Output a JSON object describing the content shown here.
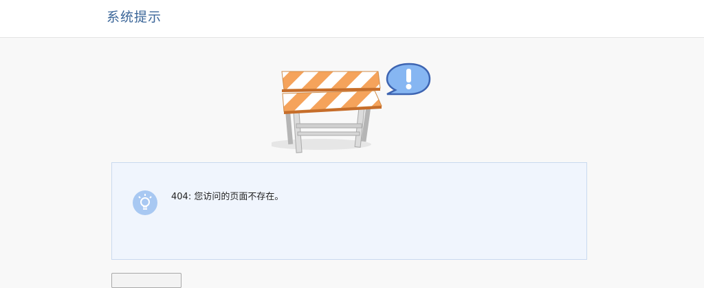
{
  "header": {
    "title": "系统提示"
  },
  "illustration": {
    "icon": "road-barrier-icon",
    "bubble_icon": "exclamation-bubble-icon"
  },
  "message": {
    "icon": "lightbulb-icon",
    "text": "404: 您访问的页面不存在。"
  },
  "colors": {
    "header_title": "#3a6598",
    "barrier_orange": "#f5a35b",
    "bubble_blue": "#5d8fd6",
    "tip_icon_blue": "#a8c8f2",
    "message_bg": "#f0f5fd",
    "message_border": "#c9d9ef"
  }
}
